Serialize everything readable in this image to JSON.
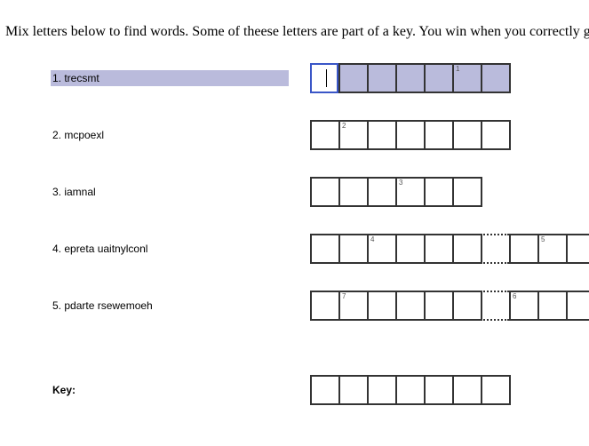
{
  "instructions": "Mix letters below to find words. Some of theese letters are part of a key. You win when you correctly g",
  "puzzles": [
    {
      "clue": "1. trecsmt",
      "active": true,
      "length": 7,
      "gap_after": null,
      "numbers": {
        "5": "1"
      }
    },
    {
      "clue": "2. mcpoexl",
      "active": false,
      "length": 7,
      "gap_after": null,
      "numbers": {
        "1": "2"
      }
    },
    {
      "clue": "3. iamnal",
      "active": false,
      "length": 6,
      "gap_after": null,
      "numbers": {
        "3": "3"
      }
    },
    {
      "clue": "4. epreta uaitnylconl",
      "active": false,
      "length": 10,
      "gap_after": 6,
      "numbers": {
        "2": "4",
        "8": "5"
      }
    },
    {
      "clue": "5. pdarte rsewemoeh",
      "active": false,
      "length": 10,
      "gap_after": 6,
      "numbers": {
        "1": "7",
        "7": "6"
      }
    }
  ],
  "key": {
    "label": "Key:",
    "length": 7
  }
}
